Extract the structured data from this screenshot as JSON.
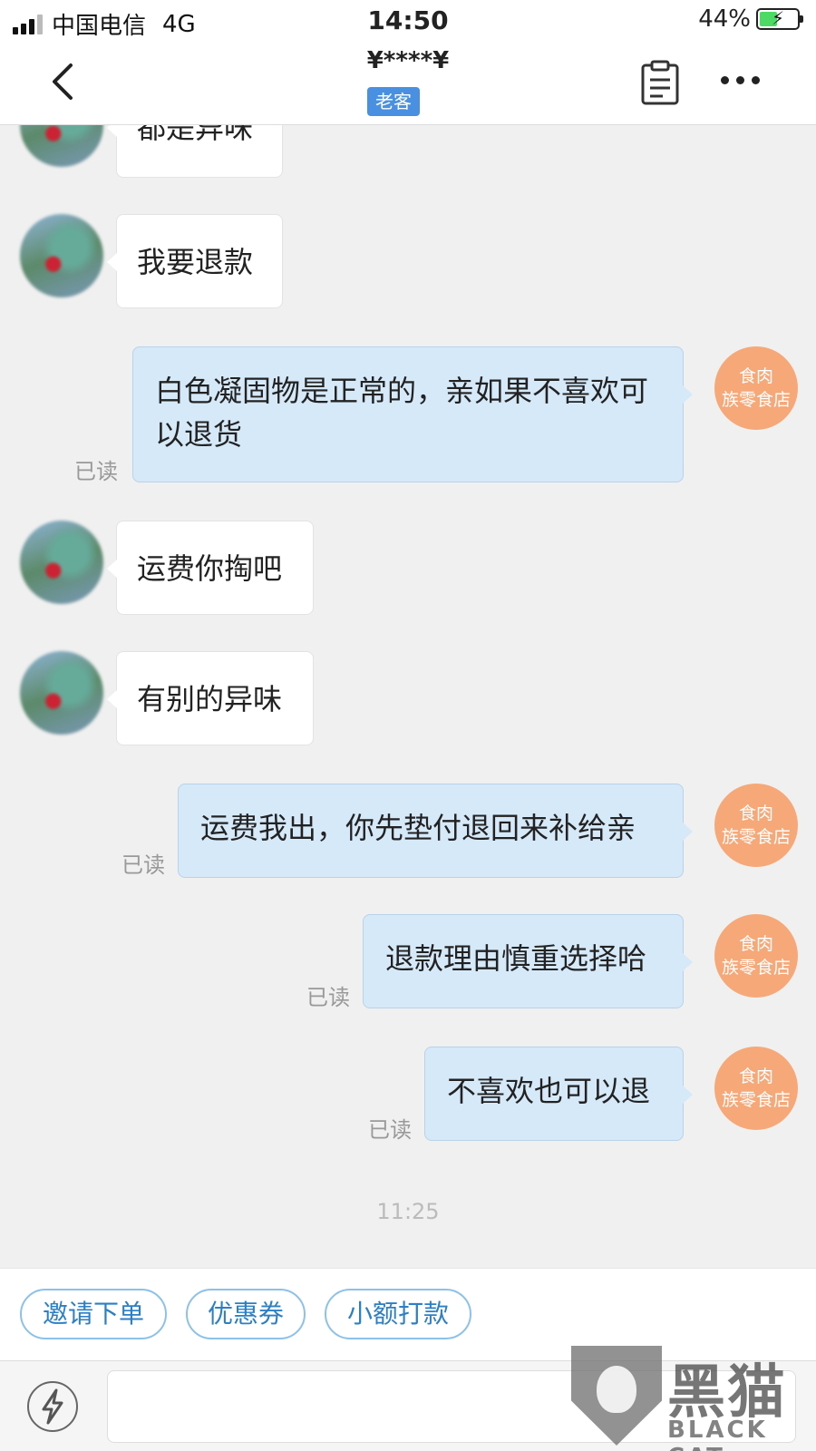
{
  "status_bar": {
    "carrier": "中国电信",
    "network": "4G",
    "time": "14:50",
    "battery": "44%",
    "battery_level": 0.44
  },
  "header": {
    "title": "¥****¥",
    "tag": "老客",
    "icons": [
      "back-arrow-icon",
      "clipboard-icon",
      "more-icon"
    ]
  },
  "shop_avatar": {
    "line1": "食肉",
    "line2": "族零食店"
  },
  "read_label": "已读",
  "messages": [
    {
      "side": "in",
      "text": "都是异味"
    },
    {
      "side": "in",
      "text": "我要退款"
    },
    {
      "side": "out",
      "text": "白色凝固物是正常的，亲如果不喜欢可以退货",
      "status": "已读"
    },
    {
      "side": "in",
      "text": "运费你掏吧"
    },
    {
      "side": "in",
      "text": "有别的异味"
    },
    {
      "side": "out",
      "text": "运费我出，你先垫付退回来补给亲",
      "status": "已读"
    },
    {
      "side": "out",
      "text": "退款理由慎重选择哈",
      "status": "已读"
    },
    {
      "side": "out",
      "text": "不喜欢也可以退",
      "status": "已读"
    }
  ],
  "timestamp": "11:25",
  "quick_actions": [
    "邀请下单",
    "优惠券",
    "小额打款"
  ],
  "input": {
    "left_icon": "lightning-icon",
    "value": ""
  },
  "watermark": {
    "logo": "黑猫",
    "text": "BLACK CAT"
  },
  "colors": {
    "outgoing_bubble": "#d6e9f9",
    "incoming_bubble": "#ffffff",
    "shop_avatar": "#f6a878",
    "tag": "#4a90e2",
    "quick_action_text": "#2a7fc7"
  }
}
